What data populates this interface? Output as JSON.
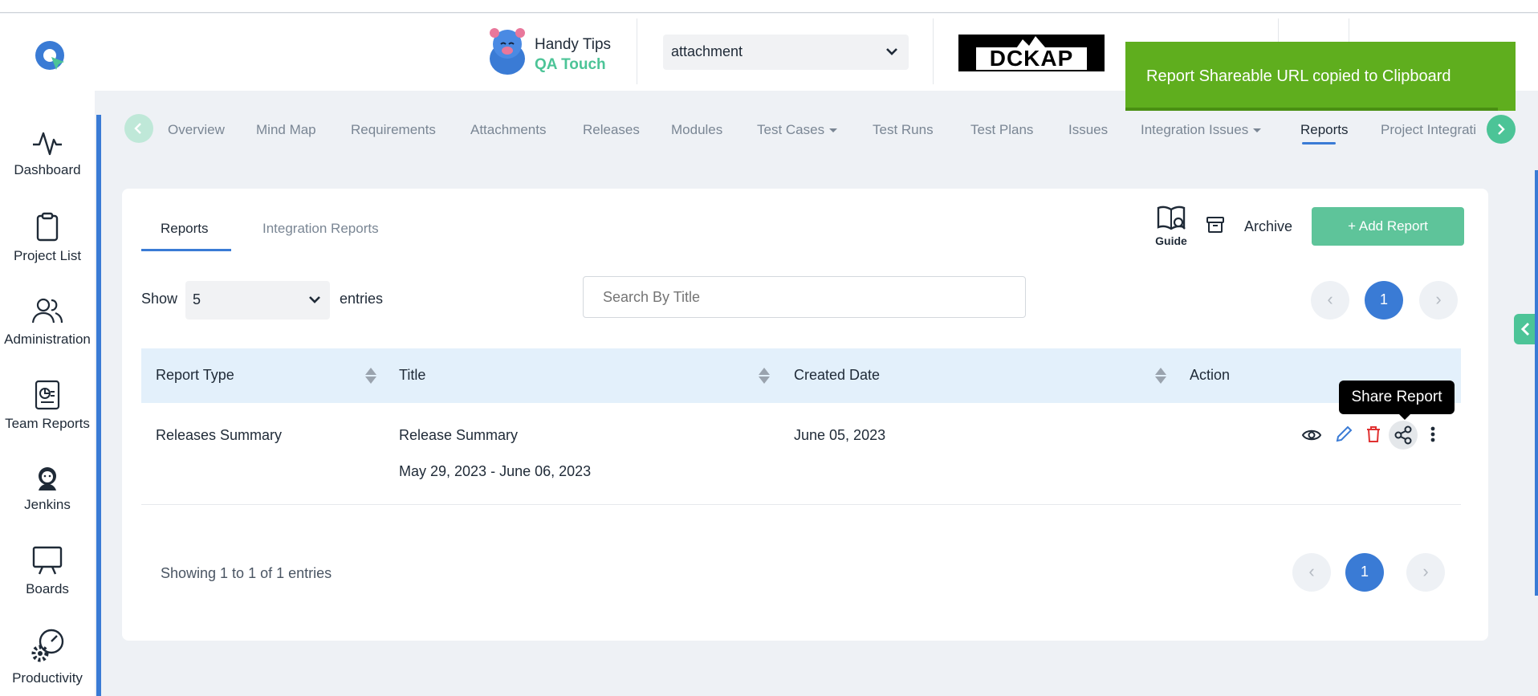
{
  "header": {
    "brand_line1": "Handy Tips",
    "brand_line2": "QA Touch",
    "project_select": "attachment",
    "org_logo_text": "DCKAP"
  },
  "toast": {
    "message": "Report Shareable URL copied to Clipboard"
  },
  "sidebar": {
    "items": [
      {
        "label": "Dashboard",
        "icon": "pulse-icon"
      },
      {
        "label": "Project List",
        "icon": "clipboard-icon"
      },
      {
        "label": "Administration",
        "icon": "users-icon"
      },
      {
        "label": "Team Reports",
        "icon": "report-chart-icon"
      },
      {
        "label": "Jenkins",
        "icon": "jenkins-icon"
      },
      {
        "label": "Boards",
        "icon": "presentation-board-icon"
      },
      {
        "label": "Productivity",
        "icon": "productivity-gears-icon"
      }
    ]
  },
  "project_tabs": {
    "items": [
      "Overview",
      "Mind Map",
      "Requirements",
      "Attachments",
      "Releases",
      "Modules",
      "Test Cases",
      "Test Runs",
      "Test Plans",
      "Issues",
      "Integration Issues",
      "Reports",
      "Project Integrati"
    ],
    "active": "Reports"
  },
  "reports": {
    "subtabs": [
      "Reports",
      "Integration Reports"
    ],
    "active_subtab": "Reports",
    "guide_label": "Guide",
    "archive_label": "Archive",
    "add_label": "+ Add Report",
    "show_label": "Show",
    "entries_value": "5",
    "entries_label": "entries",
    "search_placeholder": "Search By Title",
    "current_page": "1",
    "columns": [
      "Report Type",
      "Title",
      "Created Date",
      "Action"
    ],
    "rows": [
      {
        "report_type": "Releases Summary",
        "title": "Release Summary",
        "title_range": "May 29, 2023 - June 06, 2023",
        "created_date": "June 05, 2023"
      }
    ],
    "showing_text": "Showing 1 to 1 of 1 entries",
    "tooltip": "Share Report"
  },
  "colors": {
    "accent_blue": "#3a7bd5",
    "accent_green": "#5ec49a",
    "toast_green": "#5fae1e"
  }
}
